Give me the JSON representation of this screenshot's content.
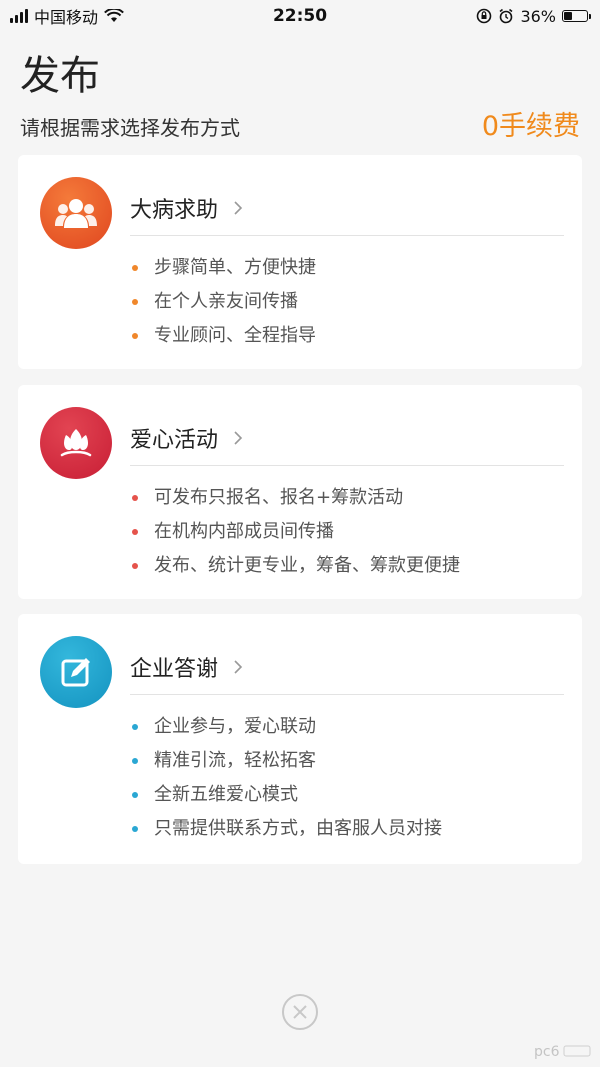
{
  "status_bar": {
    "carrier": "中国移动",
    "time": "22:50",
    "battery_percent": "36%",
    "battery_level": 0.36
  },
  "header": {
    "title": "发布",
    "subtitle": "请根据需求选择发布方式",
    "fee_badge": "0手续费"
  },
  "cards": [
    {
      "title": "大病求助",
      "icon": "people-group-icon",
      "color": "#f0872b",
      "features": [
        "步骤简单、方便快捷",
        "在个人亲友间传播",
        "专业顾问、全程指导"
      ]
    },
    {
      "title": "爱心活动",
      "icon": "lotus-icon",
      "color": "#e5534b",
      "features": [
        "可发布只报名、报名+筹款活动",
        "在机构内部成员间传播",
        "发布、统计更专业，筹备、筹款更便捷"
      ]
    },
    {
      "title": "企业答谢",
      "icon": "edit-icon",
      "color": "#2aa7d3",
      "features": [
        "企业参与，爱心联动",
        "精准引流，轻松拓客",
        "全新五维爱心模式",
        "只需提供联系方式，由客服人员对接"
      ]
    }
  ],
  "colors": {
    "accent_orange": "#f08a1c",
    "card_bg": "#ffffff",
    "page_bg": "#f5f5f5"
  }
}
